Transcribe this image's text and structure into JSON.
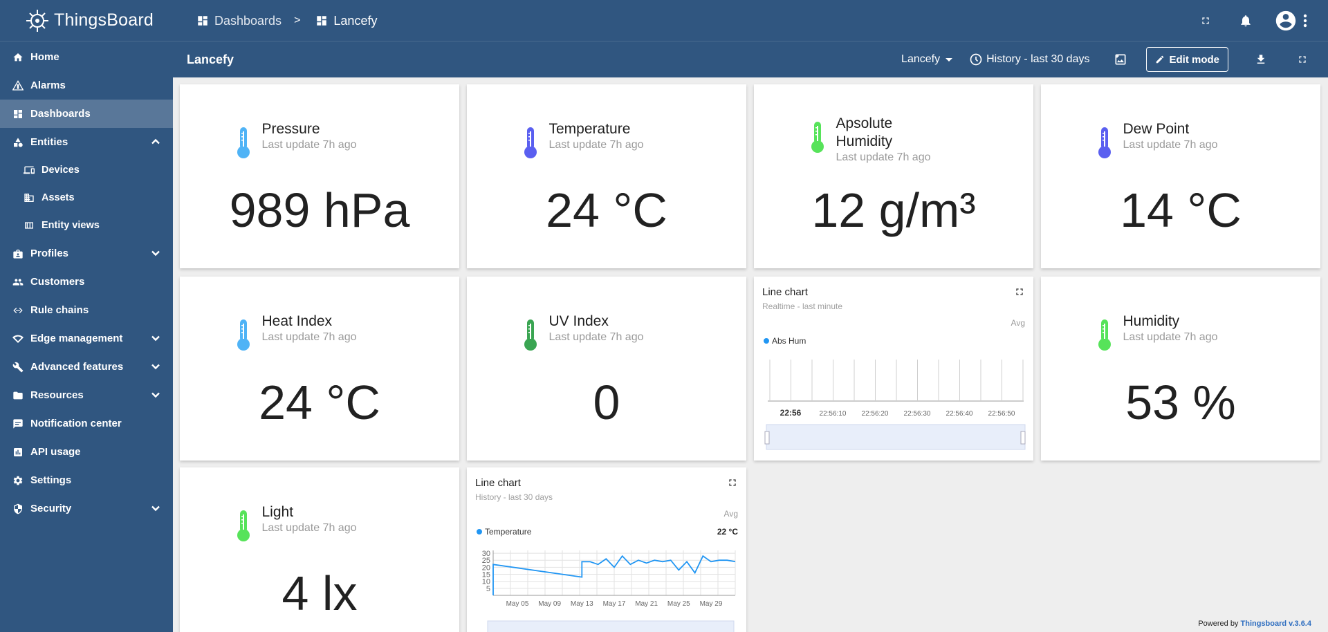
{
  "app": {
    "brand": "ThingsBoard"
  },
  "sidebar": {
    "items": [
      {
        "label": "Home",
        "icon": "home-icon"
      },
      {
        "label": "Alarms",
        "icon": "warning-icon"
      },
      {
        "label": "Dashboards",
        "icon": "dashboard-icon",
        "active": true
      },
      {
        "label": "Entities",
        "icon": "entities-icon",
        "expanded": true
      },
      {
        "label": "Devices",
        "icon": "devices-icon",
        "sub": true
      },
      {
        "label": "Assets",
        "icon": "assets-icon",
        "sub": true
      },
      {
        "label": "Entity views",
        "icon": "entity-views-icon",
        "sub": true
      },
      {
        "label": "Profiles",
        "icon": "profiles-icon",
        "collapsed": true
      },
      {
        "label": "Customers",
        "icon": "customers-icon"
      },
      {
        "label": "Rule chains",
        "icon": "rule-chains-icon"
      },
      {
        "label": "Edge management",
        "icon": "edge-icon",
        "collapsed": true
      },
      {
        "label": "Advanced features",
        "icon": "tools-icon",
        "collapsed": true
      },
      {
        "label": "Resources",
        "icon": "folder-icon",
        "collapsed": true
      },
      {
        "label": "Notification center",
        "icon": "notification-icon"
      },
      {
        "label": "API usage",
        "icon": "api-usage-icon"
      },
      {
        "label": "Settings",
        "icon": "gear-icon"
      },
      {
        "label": "Security",
        "icon": "shield-icon",
        "collapsed": true
      }
    ]
  },
  "header": {
    "breadcrumb": {
      "parent": "Dashboards",
      "separator": ">",
      "current": "Lancefy"
    }
  },
  "toolbar": {
    "title": "Lancefy",
    "state": "Lancefy",
    "timewindow": "History - last 30 days",
    "edit_label": "Edit mode"
  },
  "widgets": {
    "pressure": {
      "title": "Pressure",
      "sub": "Last update 7h ago",
      "value": "989 hPa",
      "color": "#4fb3f6"
    },
    "temperature": {
      "title": "Temperature",
      "sub": "Last update 7h ago",
      "value": "24 °C",
      "color": "#5a5ff0"
    },
    "abs_humidity": {
      "title1": "Apsolute",
      "title2": "Humidity",
      "sub": "Last update 7h ago",
      "value": "12 g/m³",
      "color": "#57e35a"
    },
    "dew_point": {
      "title": "Dew Point",
      "sub": "Last update 7h ago",
      "value": "14 °C",
      "color": "#5a5ff0"
    },
    "heat_index": {
      "title": "Heat Index",
      "sub": "Last update 7h ago",
      "value": "24 °C",
      "color": "#4fb3f6"
    },
    "uv_index": {
      "title": "UV Index",
      "sub": "Last update 7h ago",
      "value": "0",
      "color": "#3aa552"
    },
    "humidity": {
      "title": "Humidity",
      "sub": "Last update 7h ago",
      "value": "53 %",
      "color": "#57e35a"
    },
    "light": {
      "title": "Light",
      "sub": "Last update 7h ago",
      "value": "4 lx",
      "color": "#57e35a"
    },
    "line_chart_1": {
      "title": "Line chart",
      "sub": "Realtime - last minute",
      "agg": "Avg",
      "legend": "Abs Hum"
    },
    "line_chart_2": {
      "title": "Line chart",
      "sub": "History - last 30 days",
      "agg": "Avg",
      "legend": "Temperature",
      "current": "22 °C"
    }
  },
  "footer": {
    "powered": "Powered by",
    "version": "Thingsboard v.3.6.4"
  },
  "chart_data": [
    {
      "type": "line",
      "title": "Line chart",
      "subtitle": "Realtime - last minute",
      "series": [
        {
          "name": "Abs Hum",
          "values": []
        }
      ],
      "x_ticks": [
        "22:56",
        "22:56:10",
        "22:56:20",
        "22:56:30",
        "22:56:40",
        "22:56:50"
      ]
    },
    {
      "type": "line",
      "title": "Line chart",
      "subtitle": "History - last 30 days",
      "x_ticks": [
        "May 05",
        "May 09",
        "May 13",
        "May 17",
        "May 21",
        "May 25",
        "May 29"
      ],
      "y_ticks": [
        "30",
        "25",
        "20",
        "15",
        "10",
        "5"
      ],
      "ylim": [
        0,
        32
      ],
      "series": [
        {
          "name": "Temperature",
          "x": [
            "May 02",
            "May 02",
            "May 13",
            "May 13",
            "May 14",
            "May 15",
            "May 16",
            "May 17",
            "May 18",
            "May 19",
            "May 20",
            "May 21",
            "May 22",
            "May 23",
            "May 24",
            "May 25",
            "May 26",
            "May 27",
            "May 28",
            "May 29",
            "May 30",
            "May 31",
            "Jun 01"
          ],
          "values": [
            0,
            22,
            13,
            24,
            24,
            22,
            26,
            20,
            28,
            22,
            25,
            23,
            25,
            24,
            25,
            18,
            24,
            16,
            28,
            24,
            25,
            25,
            24
          ]
        }
      ]
    }
  ]
}
